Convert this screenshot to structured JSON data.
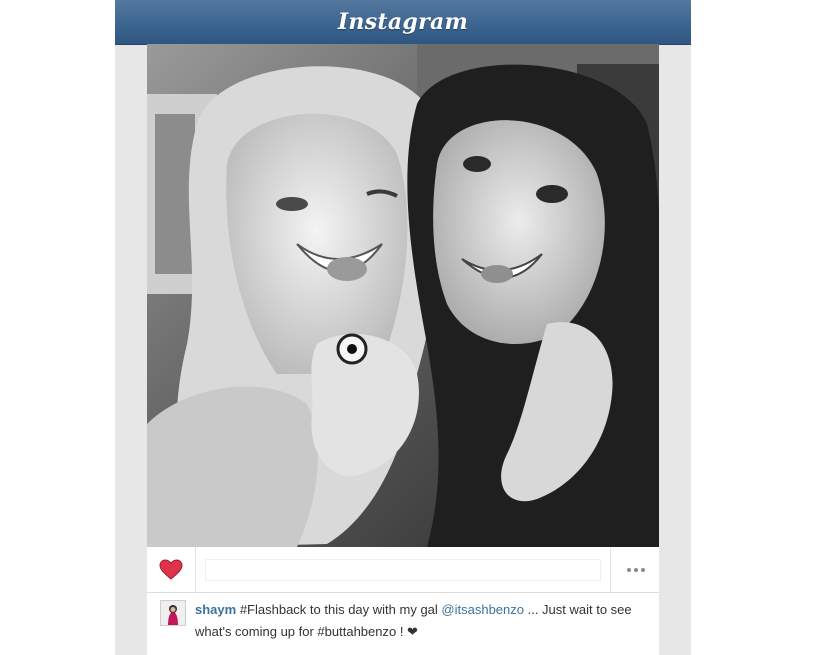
{
  "app": {
    "title": "Instagram"
  },
  "post": {
    "username": "shaym",
    "caption_part1": " #Flashback to this day with my gal ",
    "mention": "@itsashbenzo",
    "caption_part2": " ... Just wait to see what's coming up for #buttahbenzo ! ❤︎",
    "liked": true
  },
  "actions": {
    "like_icon": "heart-icon",
    "more_icon": "more-options-icon",
    "comment_placeholder": ""
  },
  "colors": {
    "header_blue": "#3c6591",
    "link_blue": "#3f729b",
    "like_red": "#e0334a"
  }
}
